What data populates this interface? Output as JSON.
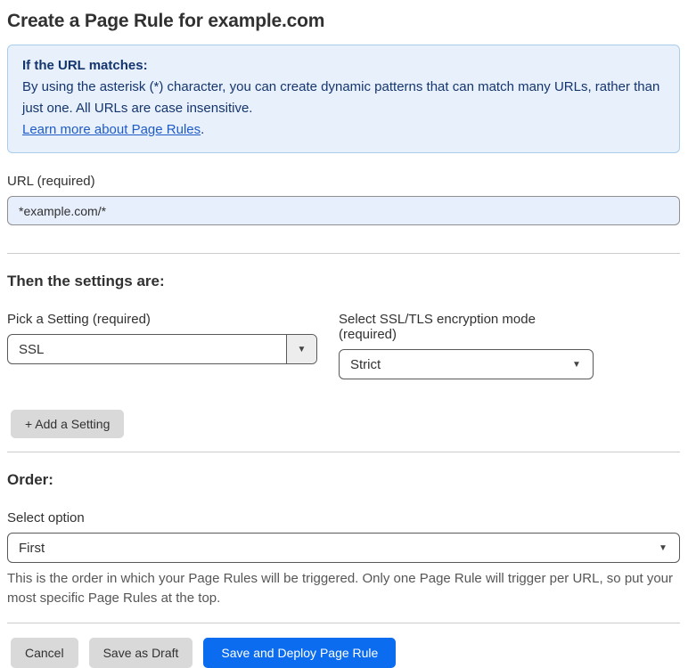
{
  "page": {
    "title": "Create a Page Rule for example.com"
  },
  "info_box": {
    "heading": "If the URL matches:",
    "body": "By using the asterisk (*) character, you can create dynamic patterns that can match many URLs, rather than just one. All URLs are case insensitive.",
    "link_label": "Learn more about Page Rules",
    "link_suffix": "."
  },
  "url_field": {
    "label": "URL (required)",
    "value": "*example.com/*"
  },
  "settings_section": {
    "heading": "Then the settings are:",
    "setting_picker": {
      "label": "Pick a Setting (required)",
      "value": "SSL"
    },
    "mode_picker": {
      "label": "Select SSL/TLS encryption mode (required)",
      "value": "Strict"
    },
    "add_setting_label": "+ Add a Setting",
    "dropdown_arrow_icon": "▼"
  },
  "order_section": {
    "heading": "Order:",
    "label": "Select option",
    "value": "First",
    "dropdown_arrow_icon": "▼",
    "help_text": "This is the order in which your Page Rules will be triggered. Only one Page Rule will trigger per URL, so put your most specific Page Rules at the top."
  },
  "footer": {
    "cancel_label": "Cancel",
    "save_draft_label": "Save as Draft",
    "save_deploy_label": "Save and Deploy Page Rule"
  },
  "colors": {
    "accent_blue": "#0b6cf0",
    "info_background": "#e8f1fb",
    "info_border": "#a9cdec",
    "info_text": "#15356f",
    "link_blue": "#1f5bc7",
    "url_input_background": "#e7effc",
    "gray_button": "#d9d9d9"
  }
}
